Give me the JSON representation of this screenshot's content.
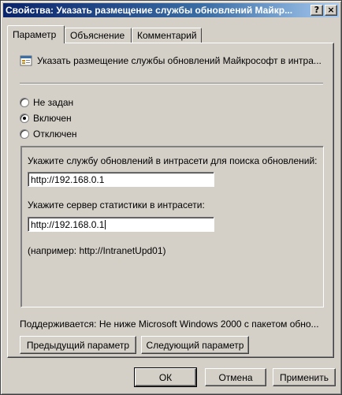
{
  "window": {
    "title": "Свойства: Указать размещение службы обновлений Майкр...",
    "help_glyph": "?",
    "close_glyph": "×"
  },
  "tabs": [
    {
      "label": "Параметр",
      "active": true
    },
    {
      "label": "Объяснение",
      "active": false
    },
    {
      "label": "Комментарий",
      "active": false
    }
  ],
  "policy": {
    "icon": "policy-setting-icon",
    "name": "Указать размещение службы обновлений Майкрософт в интра..."
  },
  "radios": [
    {
      "label": "Не задан",
      "selected": false
    },
    {
      "label": "Включен",
      "selected": true
    },
    {
      "label": "Отключен",
      "selected": false
    }
  ],
  "options": {
    "update_service_label": "Укажите службу обновлений в интрасети для поиска обновлений:",
    "update_service_value": "http://192.168.0.1",
    "stats_server_label": "Укажите сервер статистики в интрасети:",
    "stats_server_value": "http://192.168.0.1",
    "example": "(например: http://IntranetUpd01)"
  },
  "supported": "Поддерживается:   Не ниже Microsoft Windows 2000 с пакетом обно...",
  "nav": {
    "prev": "Предыдущий параметр",
    "next": "Следующий параметр"
  },
  "footer": {
    "ok": "ОК",
    "cancel": "Отмена",
    "apply": "Применить"
  },
  "colors": {
    "face": "#d4d0c8",
    "title_start": "#0a246a",
    "title_end": "#a6caf0"
  }
}
